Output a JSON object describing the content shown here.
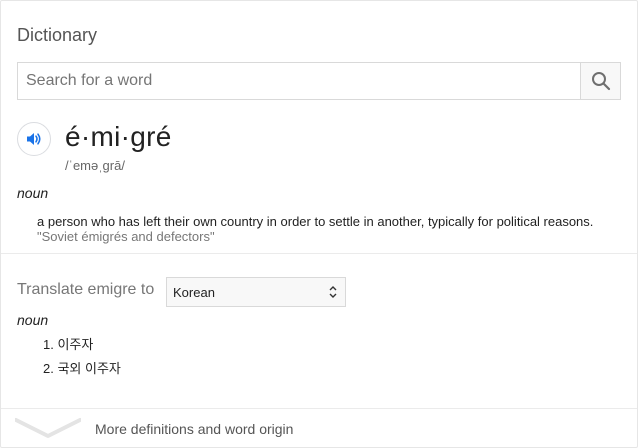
{
  "header": {
    "title": "Dictionary"
  },
  "search": {
    "placeholder": "Search for a word",
    "value": "",
    "icon": "search-icon"
  },
  "entry": {
    "speaker_icon": "speaker-icon",
    "headword": "é·mi·gré",
    "phonetic": "/ˈeməˌɡrā/",
    "part_of_speech": "noun",
    "definition": "a person who has left their own country in order to settle in another, typically for political reasons.",
    "example": "\"Soviet émigrés and defectors\""
  },
  "translate": {
    "label": "Translate emigre to",
    "selected_language": "Korean",
    "part_of_speech": "noun",
    "items": [
      {
        "number": "1.",
        "text": "이주자"
      },
      {
        "number": "2.",
        "text": "국외 이주자"
      }
    ]
  },
  "footer": {
    "more_label": "More definitions and word origin",
    "icon": "chevron-down-icon"
  },
  "colors": {
    "accent": "#1a73e8",
    "border": "#dadce0",
    "muted_text": "#777777"
  }
}
